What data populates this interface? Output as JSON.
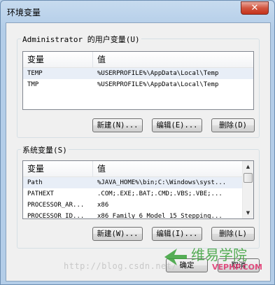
{
  "window": {
    "title": "环境变量",
    "close_glyph": "✕"
  },
  "user_vars": {
    "group_label": "Administrator 的用户变量(U)",
    "headers": [
      "变量",
      "值"
    ],
    "rows": [
      {
        "name": "TEMP",
        "value": "%USERPROFILE%\\AppData\\Local\\Temp"
      },
      {
        "name": "TMP",
        "value": "%USERPROFILE%\\AppData\\Local\\Temp"
      }
    ],
    "buttons": {
      "new": "新建(N)...",
      "edit": "编辑(E)...",
      "delete": "删除(D)"
    }
  },
  "system_vars": {
    "group_label": "系统变量(S)",
    "headers": [
      "变量",
      "值"
    ],
    "rows": [
      {
        "name": "Path",
        "value": "%JAVA_HOME%\\bin;C:\\Windows\\syst..."
      },
      {
        "name": "PATHEXT",
        "value": ".COM;.EXE;.BAT;.CMD;.VBS;.VBE;..."
      },
      {
        "name": "PROCESSOR_AR...",
        "value": "x86"
      },
      {
        "name": "PROCESSOR_ID...",
        "value": "x86 Family 6 Model 15 Stepping..."
      }
    ],
    "buttons": {
      "new": "新建(W)...",
      "edit": "编辑(I)...",
      "delete": "删除(L)"
    }
  },
  "footer": {
    "ok": "确定",
    "cancel": "取消"
  },
  "watermark": {
    "url": "http://blog.csdn.net/",
    "logo_text": "维易学院",
    "logo_sub": "VEPHP.COM"
  },
  "colors": {
    "accent_green": "#3aa13a",
    "logo_pink": "#e0336e"
  }
}
